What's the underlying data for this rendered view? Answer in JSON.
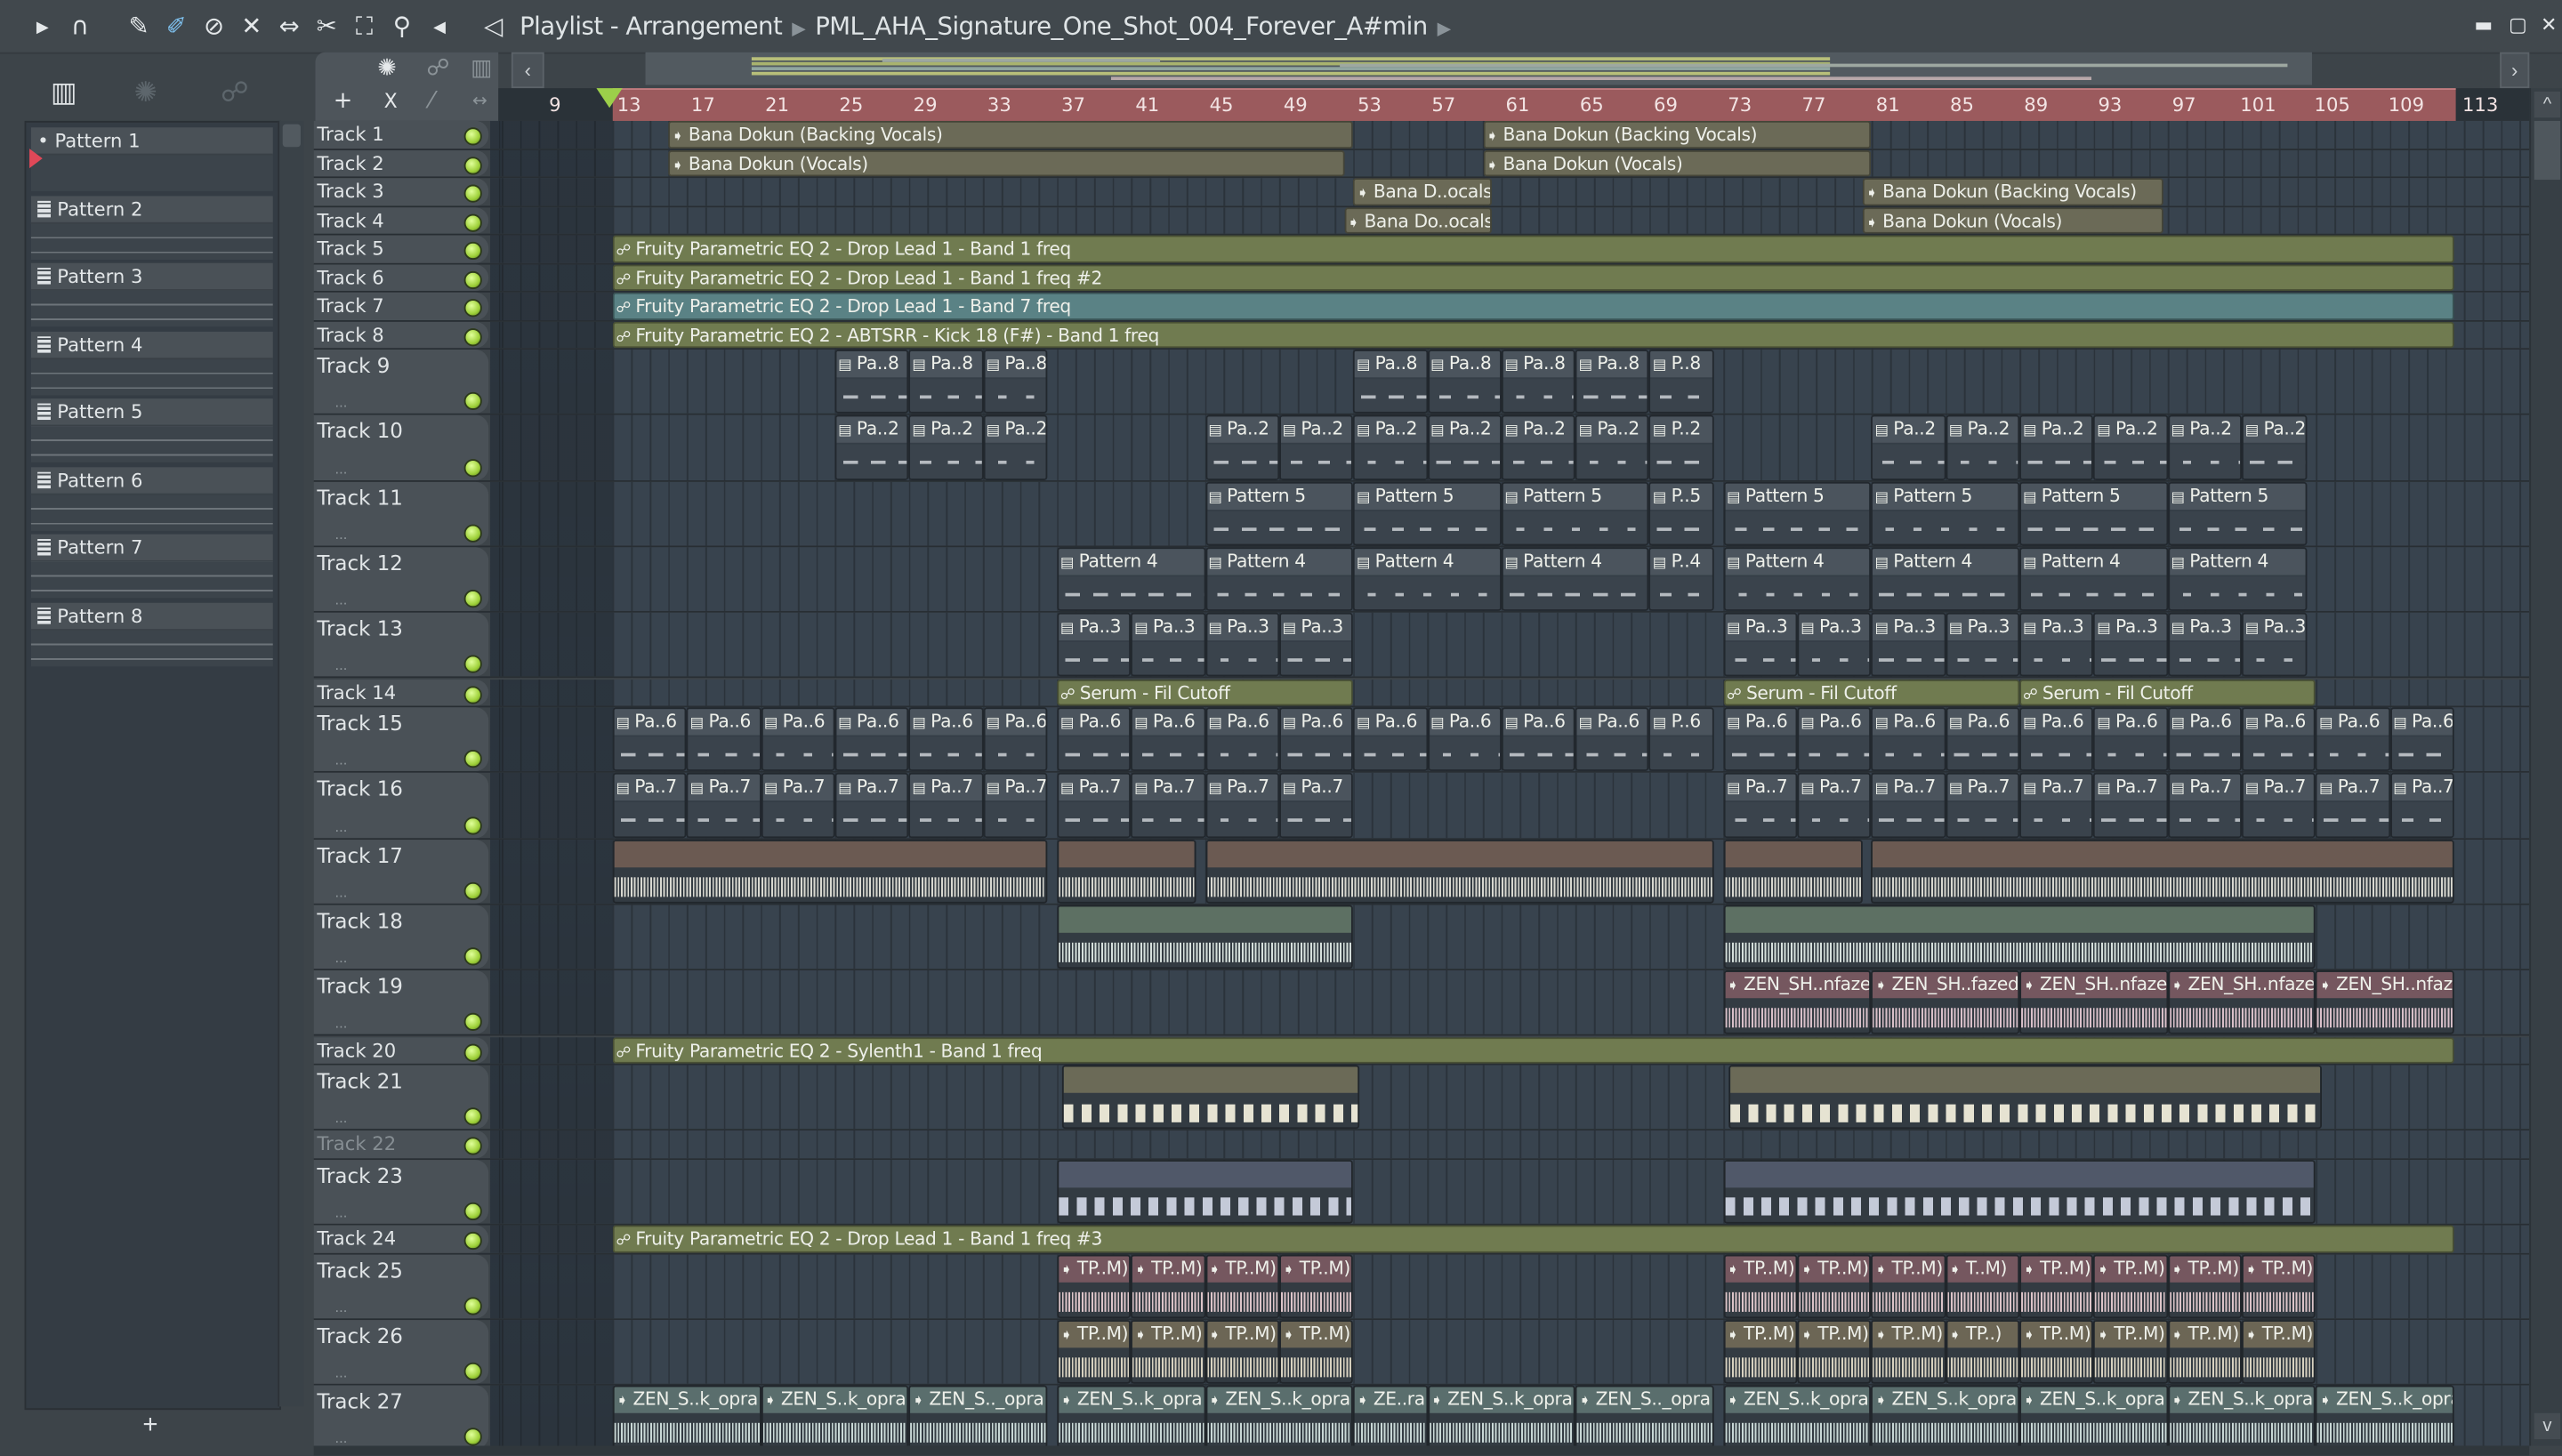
{
  "window": {
    "title_parts": [
      "Playlist - Arrangement",
      "PML_AHA_Signature_One_Shot_004_Forever_A#min"
    ],
    "controls": [
      "minimize",
      "maximize",
      "close"
    ],
    "control_glyphs": [
      "▬",
      "▢",
      "✕"
    ]
  },
  "toolbar": {
    "icons": [
      {
        "name": "menu-arrow-icon",
        "glyph": "▸"
      },
      {
        "name": "magnet-snap-icon",
        "glyph": "∩"
      },
      {
        "name": "draw-pencil-icon",
        "glyph": "✎"
      },
      {
        "name": "paint-brush-icon",
        "glyph": "✐",
        "active": true
      },
      {
        "name": "delete-icon",
        "glyph": "⊘"
      },
      {
        "name": "mute-icon",
        "glyph": "✕"
      },
      {
        "name": "slip-icon",
        "glyph": "⇔"
      },
      {
        "name": "slice-icon",
        "glyph": "✂"
      },
      {
        "name": "select-icon",
        "glyph": "⛶"
      },
      {
        "name": "zoom-icon",
        "glyph": "⚲"
      },
      {
        "name": "playback-icon",
        "glyph": "◂"
      },
      {
        "name": "speaker-icon",
        "glyph": "◁"
      }
    ]
  },
  "picker": {
    "tools": [
      "piano-roll",
      "audio",
      "automation"
    ],
    "patterns": [
      "Pattern 1",
      "Pattern 2",
      "Pattern 3",
      "Pattern 4",
      "Pattern 5",
      "Pattern 6",
      "Pattern 7",
      "Pattern 8"
    ],
    "add_label": "+"
  },
  "playlist_tools": {
    "add": "+",
    "cut": "X",
    "arrow_left": "‹",
    "arrow_right": "›",
    "scroll_up": "^",
    "scroll_down": "v"
  },
  "ruler": {
    "labels": [
      "9",
      "13",
      "17",
      "21",
      "25",
      "29",
      "33",
      "37",
      "41",
      "45",
      "49",
      "53",
      "57",
      "61",
      "65",
      "69",
      "73",
      "77",
      "81",
      "85",
      "89",
      "93",
      "97",
      "101",
      "105",
      "109",
      "113"
    ],
    "selection_bars": [
      13,
      112.5
    ]
  },
  "colors": {
    "audio": "#6b6a57",
    "auto": "#707b50",
    "auto_teal": "#5a8285",
    "pattern": "#4b545d",
    "pink": "#75575f",
    "beige": "#6c6655",
    "teal_audio": "#5a6e6d",
    "brown": "#6b5a52",
    "green_audio": "#5d7063",
    "blue_audio": "#505869"
  },
  "tracks": [
    {
      "name": "Track 1",
      "kind": "audio",
      "color": "audio",
      "clips": [
        [
          "Bana Dokun (Backing Vocals)",
          16,
          37
        ],
        [
          "Bana Dokun (Backing Vocals)",
          60,
          21
        ]
      ]
    },
    {
      "name": "Track 2",
      "kind": "audio",
      "color": "audio",
      "clips": [
        [
          "Bana Dokun (Vocals)",
          16,
          36.5
        ],
        [
          "Bana Dokun (Vocals)",
          60,
          21
        ]
      ]
    },
    {
      "name": "Track 3",
      "kind": "audio",
      "color": "audio",
      "clips": [
        [
          "Bana D..ocals)",
          53,
          7.5
        ],
        [
          "Bana Dokun (Backing Vocals)",
          80.5,
          16.3
        ]
      ]
    },
    {
      "name": "Track 4",
      "kind": "audio",
      "color": "audio",
      "clips": [
        [
          "Bana Do..ocals)",
          52.5,
          8
        ],
        [
          "Bana Dokun (Vocals)",
          80.5,
          16.3
        ]
      ]
    },
    {
      "name": "Track 5",
      "kind": "auto",
      "color": "auto",
      "clips": [
        [
          "Fruity Parametric EQ 2 - Drop Lead 1 - Band 1 freq",
          13,
          99.5
        ]
      ]
    },
    {
      "name": "Track 6",
      "kind": "auto",
      "color": "auto",
      "clips": [
        [
          "Fruity Parametric EQ 2 - Drop Lead 1 - Band 1 freq #2",
          13,
          99.5
        ]
      ]
    },
    {
      "name": "Track 7",
      "kind": "auto",
      "color": "auto_teal",
      "clips": [
        [
          "Fruity Parametric EQ 2 - Drop Lead 1 - Band 7 freq",
          13,
          99.5
        ]
      ]
    },
    {
      "name": "Track 8",
      "kind": "auto",
      "color": "auto",
      "clips": [
        [
          "Fruity Parametric EQ 2 - ABTSRR - Kick 18 (F#) - Band 1 freq",
          13,
          99.5
        ]
      ]
    },
    {
      "name": "Track 9",
      "kind": "pattern",
      "color": "pattern",
      "clips": [
        [
          "Pa..8",
          25,
          4
        ],
        [
          "Pa..8",
          29,
          4
        ],
        [
          "Pa..8",
          33,
          3.5
        ],
        [
          "Pa..8",
          53,
          4
        ],
        [
          "Pa..8",
          57,
          4
        ],
        [
          "Pa..8",
          61,
          4
        ],
        [
          "Pa..8",
          65,
          4
        ],
        [
          "P..8",
          69,
          3.5
        ]
      ]
    },
    {
      "name": "Track 10",
      "kind": "pattern",
      "color": "pattern",
      "clips": [
        [
          "Pa..2",
          25,
          4
        ],
        [
          "Pa..2",
          29,
          4
        ],
        [
          "Pa..2",
          33,
          3.5
        ],
        [
          "Pa..2",
          45,
          4
        ],
        [
          "Pa..2",
          49,
          4
        ],
        [
          "Pa..2",
          53,
          4
        ],
        [
          "Pa..2",
          57,
          4
        ],
        [
          "Pa..2",
          61,
          4
        ],
        [
          "Pa..2",
          65,
          4
        ],
        [
          "P..2",
          69,
          3.5
        ],
        [
          "Pa..2",
          81,
          4
        ],
        [
          "Pa..2",
          85,
          4
        ],
        [
          "Pa..2",
          89,
          4
        ],
        [
          "Pa..2",
          93,
          4
        ],
        [
          "Pa..2",
          97,
          4
        ],
        [
          "Pa..2",
          101,
          3.5
        ]
      ]
    },
    {
      "name": "Track 11",
      "kind": "pattern",
      "color": "pattern",
      "clips": [
        [
          "Pattern 5",
          45,
          8
        ],
        [
          "Pattern 5",
          53,
          8
        ],
        [
          "Pattern 5",
          61,
          8
        ],
        [
          "P..5",
          69,
          3.5
        ],
        [
          "Pattern 5",
          73,
          8
        ],
        [
          "Pattern 5",
          81,
          8
        ],
        [
          "Pattern 5",
          89,
          8
        ],
        [
          "Pattern 5",
          97,
          7.5
        ]
      ]
    },
    {
      "name": "Track 12",
      "kind": "pattern",
      "color": "pattern",
      "clips": [
        [
          "Pattern 4",
          37,
          8
        ],
        [
          "Pattern 4",
          45,
          8
        ],
        [
          "Pattern 4",
          53,
          8
        ],
        [
          "Pattern 4",
          61,
          8
        ],
        [
          "P..4",
          69,
          3.5
        ],
        [
          "Pattern 4",
          73,
          8
        ],
        [
          "Pattern 4",
          81,
          8
        ],
        [
          "Pattern 4",
          89,
          8
        ],
        [
          "Pattern 4",
          97,
          7.5
        ]
      ]
    },
    {
      "name": "Track 13",
      "kind": "pattern",
      "color": "pattern",
      "clips": [
        [
          "Pa..3",
          37,
          4
        ],
        [
          "Pa..3",
          41,
          4
        ],
        [
          "Pa..3",
          45,
          4
        ],
        [
          "Pa..3",
          49,
          4
        ],
        [
          "Pa..3",
          73,
          4
        ],
        [
          "Pa..3",
          77,
          4
        ],
        [
          "Pa..3",
          81,
          4
        ],
        [
          "Pa..3",
          85,
          4
        ],
        [
          "Pa..3",
          89,
          4
        ],
        [
          "Pa..3",
          93,
          4
        ],
        [
          "Pa..3",
          97,
          4
        ],
        [
          "Pa..3",
          101,
          3.5
        ]
      ]
    },
    {
      "name": "Track 14",
      "kind": "auto",
      "color": "auto",
      "clips": [
        [
          "Serum - Fil Cutoff",
          37,
          16
        ],
        [
          "Serum - Fil Cutoff",
          73,
          16
        ],
        [
          "Serum - Fil Cutoff",
          89,
          16
        ]
      ]
    },
    {
      "name": "Track 15",
      "kind": "pattern",
      "color": "pattern",
      "clips": [
        [
          "Pa..6",
          13,
          4
        ],
        [
          "Pa..6",
          17,
          4
        ],
        [
          "Pa..6",
          21,
          4
        ],
        [
          "Pa..6",
          25,
          4
        ],
        [
          "Pa..6",
          29,
          4
        ],
        [
          "Pa..6",
          33,
          3.5
        ],
        [
          "Pa..6",
          37,
          4
        ],
        [
          "Pa..6",
          41,
          4
        ],
        [
          "Pa..6",
          45,
          4
        ],
        [
          "Pa..6",
          49,
          4
        ],
        [
          "Pa..6",
          53,
          4
        ],
        [
          "Pa..6",
          57,
          4
        ],
        [
          "Pa..6",
          61,
          4
        ],
        [
          "Pa..6",
          65,
          4
        ],
        [
          "P..6",
          69,
          3.5
        ],
        [
          "Pa..6",
          73,
          4
        ],
        [
          "Pa..6",
          77,
          4
        ],
        [
          "Pa..6",
          81,
          4
        ],
        [
          "Pa..6",
          85,
          4
        ],
        [
          "Pa..6",
          89,
          4
        ],
        [
          "Pa..6",
          93,
          4
        ],
        [
          "Pa..6",
          97,
          4
        ],
        [
          "Pa..6",
          101,
          4
        ],
        [
          "Pa..6",
          105,
          4
        ],
        [
          "Pa..6",
          109,
          3.5
        ]
      ]
    },
    {
      "name": "Track 16",
      "kind": "pattern",
      "color": "pattern",
      "clips": [
        [
          "Pa..7",
          13,
          4
        ],
        [
          "Pa..7",
          17,
          4
        ],
        [
          "Pa..7",
          21,
          4
        ],
        [
          "Pa..7",
          25,
          4
        ],
        [
          "Pa..7",
          29,
          4
        ],
        [
          "Pa..7",
          33,
          3.5
        ],
        [
          "Pa..7",
          37,
          4
        ],
        [
          "Pa..7",
          41,
          4
        ],
        [
          "Pa..7",
          45,
          4
        ],
        [
          "Pa..7",
          49,
          4
        ],
        [
          "Pa..7",
          73,
          4
        ],
        [
          "Pa..7",
          77,
          4
        ],
        [
          "Pa..7",
          81,
          4
        ],
        [
          "Pa..7",
          85,
          4
        ],
        [
          "Pa..7",
          89,
          4
        ],
        [
          "Pa..7",
          93,
          4
        ],
        [
          "Pa..7",
          97,
          4
        ],
        [
          "Pa..7",
          101,
          4
        ],
        [
          "Pa..7",
          105,
          4
        ],
        [
          "Pa..7",
          109,
          3.5
        ]
      ]
    },
    {
      "name": "Track 17",
      "kind": "wave",
      "color": "brown",
      "wave": "#d8d8d0",
      "clips": [
        [
          "",
          13,
          23.5
        ],
        [
          "",
          37,
          7.5
        ],
        [
          "",
          45,
          27.5
        ],
        [
          "",
          73,
          7.5
        ],
        [
          "",
          81,
          31.5
        ]
      ]
    },
    {
      "name": "Track 18",
      "kind": "wave",
      "color": "green_audio",
      "wave": "#d6e0dc",
      "clips": [
        [
          "",
          37,
          16
        ],
        [
          "",
          73,
          32
        ]
      ]
    },
    {
      "name": "Track 19",
      "kind": "wave",
      "color": "pink",
      "wave": "#d9c0c9",
      "clips": [
        [
          "ZEN_SH..nfazed",
          73,
          8
        ],
        [
          "ZEN_SH..fazed",
          81,
          8
        ],
        [
          "ZEN_SH..nfazed",
          89,
          8
        ],
        [
          "ZEN_SH..nfazed",
          97,
          8
        ],
        [
          "ZEN_SH..nfazed",
          105,
          7.5
        ]
      ]
    },
    {
      "name": "Track 20",
      "kind": "auto",
      "color": "auto",
      "clips": [
        [
          "Fruity Parametric EQ 2 - Sylenth1 - Band 1 freq",
          13,
          99.5
        ]
      ]
    },
    {
      "name": "Track 21",
      "kind": "blocks",
      "color": "audio",
      "wave": "#e6e3d2",
      "clips": [
        [
          "",
          37.3,
          16
        ],
        [
          "",
          73.3,
          32
        ]
      ]
    },
    {
      "name": "Track 22",
      "kind": "empty",
      "dimmed": true,
      "clips": []
    },
    {
      "name": "Track 23",
      "kind": "blocks",
      "color": "blue_audio",
      "wave": "#c4cad8",
      "clips": [
        [
          "",
          37,
          16
        ],
        [
          "",
          73,
          32
        ]
      ]
    },
    {
      "name": "Track 24",
      "kind": "auto",
      "color": "auto",
      "clips": [
        [
          "Fruity Parametric EQ 2 - Drop Lead 1 - Band 1 freq #3",
          13,
          99.5
        ]
      ]
    },
    {
      "name": "Track 25",
      "kind": "wave",
      "color": "pink",
      "wave": "#dcc4c8",
      "clips": [
        [
          "TP..M)",
          37,
          4
        ],
        [
          "TP..M)",
          41,
          4
        ],
        [
          "TP..M)",
          45,
          4
        ],
        [
          "TP..M)",
          49,
          4
        ],
        [
          "TP..M)",
          73,
          4
        ],
        [
          "TP..M)",
          77,
          4
        ],
        [
          "TP..M)",
          81,
          4
        ],
        [
          "T..M)",
          85,
          4
        ],
        [
          "TP..M)",
          89,
          4
        ],
        [
          "TP..M)",
          93,
          4
        ],
        [
          "TP..M)",
          97,
          4
        ],
        [
          "TP..M)",
          101,
          4
        ]
      ]
    },
    {
      "name": "Track 26",
      "kind": "wave",
      "color": "beige",
      "wave": "#d8d2c0",
      "clips": [
        [
          "TP..M)",
          37,
          4
        ],
        [
          "TP..M)",
          41,
          4
        ],
        [
          "TP..M)",
          45,
          4
        ],
        [
          "TP..M)",
          49,
          4
        ],
        [
          "TP..M)",
          73,
          4
        ],
        [
          "TP..M)",
          77,
          4
        ],
        [
          "TP..M)",
          81,
          4
        ],
        [
          "TP..)",
          85,
          4
        ],
        [
          "TP..M)",
          89,
          4
        ],
        [
          "TP..M)",
          93,
          4
        ],
        [
          "TP..M)",
          97,
          4
        ],
        [
          "TP..M)",
          101,
          4
        ]
      ]
    },
    {
      "name": "Track 27",
      "kind": "wave",
      "color": "teal_audio",
      "wave": "#c9d8d6",
      "clips": [
        [
          "ZEN_S..k_opra",
          13,
          8
        ],
        [
          "ZEN_S..k_opra",
          21,
          8
        ],
        [
          "ZEN_S.._opra",
          29,
          7.5
        ],
        [
          "ZEN_S..k_opra",
          37,
          8
        ],
        [
          "ZEN_S..k_opra",
          45,
          8
        ],
        [
          "ZE..ra",
          53,
          4
        ],
        [
          "ZEN_S..k_opra",
          57,
          8
        ],
        [
          "ZEN_S.._opra",
          65,
          7.5
        ],
        [
          "ZEN_S..k_opra",
          73,
          8
        ],
        [
          "ZEN_S..k_opra",
          81,
          8
        ],
        [
          "ZEN_S..k_opra",
          89,
          8
        ],
        [
          "ZEN_S..k_opra",
          97,
          8
        ],
        [
          "ZEN_S..k_opra",
          105,
          7.5
        ]
      ]
    }
  ]
}
